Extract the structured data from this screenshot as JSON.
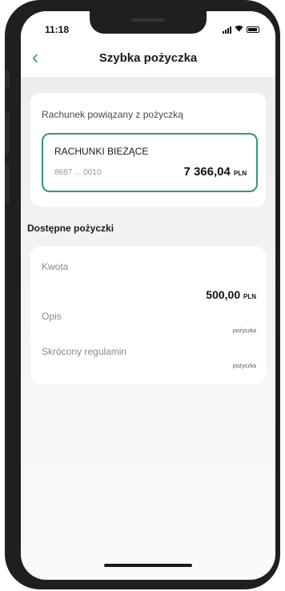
{
  "status": {
    "time": "11:18",
    "wifi_icon": "wifi-icon",
    "battery_icon": "battery-icon"
  },
  "header": {
    "title": "Szybka pożyczka",
    "back_icon": "chevron-left-icon",
    "back_glyph": "‹",
    "accent_color": "#2e9c6a"
  },
  "linked_account": {
    "label": "Rachunek powiązany z pożyczką",
    "account_name": "RACHUNKI BIEŻĄCE",
    "account_number": "8687 ... 0010",
    "balance": "7 366,04",
    "currency": "PLN"
  },
  "loans": {
    "section_title": "Dostępne pożyczki",
    "amount_label": "Kwota",
    "amount_value": "500,00",
    "amount_currency": "PLN",
    "description_label": "Opis",
    "description_value": "pożyczka",
    "terms_label": "Skrócony regulamin",
    "terms_value": "pożyczka"
  }
}
